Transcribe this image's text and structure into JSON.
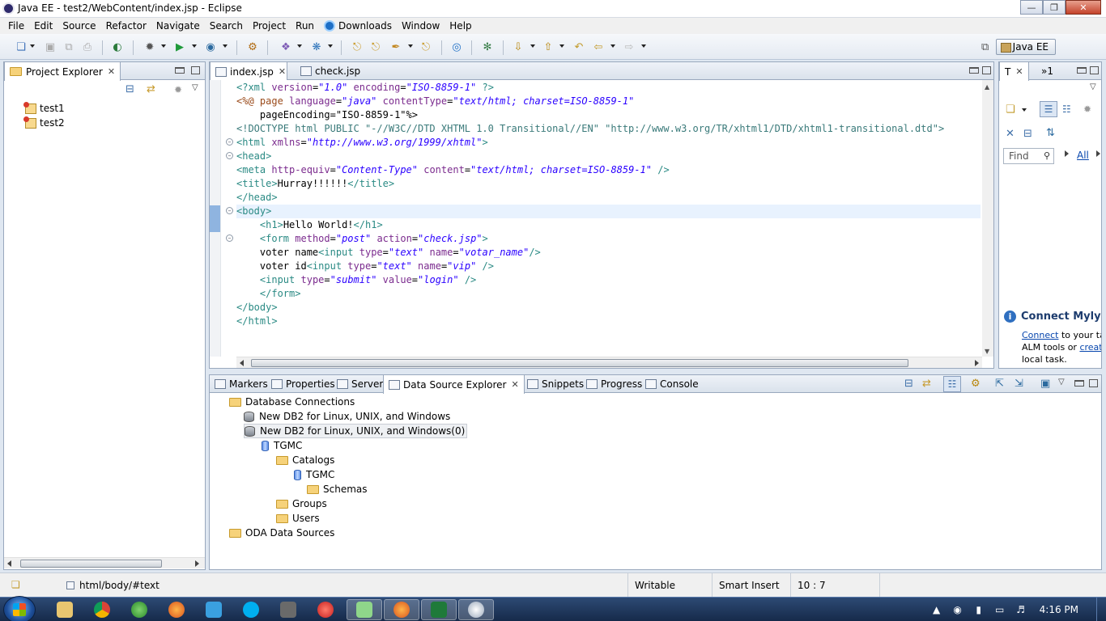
{
  "window": {
    "title": "Java EE - test2/WebContent/index.jsp - Eclipse"
  },
  "menubar": {
    "items": [
      "File",
      "Edit",
      "Source",
      "Refactor",
      "Navigate",
      "Search",
      "Project",
      "Run",
      "Downloads",
      "Window",
      "Help"
    ]
  },
  "perspective": {
    "label": "Java EE"
  },
  "project_explorer": {
    "title": "Project Explorer",
    "projects": [
      "test1",
      "test2"
    ]
  },
  "editor": {
    "tabs": [
      "index.jsp",
      "check.jsp"
    ],
    "lines": [
      "<?xml version=\"1.0\" encoding=\"ISO-8859-1\" ?>",
      "<%@ page language=\"java\" contentType=\"text/html; charset=ISO-8859-1\"",
      "    pageEncoding=\"ISO-8859-1\"%>",
      "<!DOCTYPE html PUBLIC \"-//W3C//DTD XHTML 1.0 Transitional//EN\" \"http://www.w3.org/TR/xhtml1/DTD/xhtml1-transitional.dtd\">",
      "<html xmlns=\"http://www.w3.org/1999/xhtml\">",
      "<head>",
      "<meta http-equiv=\"Content-Type\" content=\"text/html; charset=ISO-8859-1\" />",
      "<title>Hurray!!!!!!</title>",
      "</head>",
      "<body>",
      "    <h1>Hello World!</h1>",
      "    <form method=\"post\" action=\"check.jsp\">",
      "    voter name<input type=\"text\" name=\"votar_name\"/>",
      "    voter id<input type=\"text\" name=\"vip\" />",
      "    <input type=\"submit\" value=\"login\" />",
      "    </form>",
      "</body>",
      "</html>"
    ]
  },
  "task_list": {
    "tab_label": "T",
    "overflow_label": "»1",
    "find_placeholder": "Find",
    "all_label": "All"
  },
  "mylyn": {
    "title": "Connect Mylyn",
    "connect_link": "Connect",
    "line1_rest": " to your ta",
    "line2_prefix": "ALM tools or ",
    "create_link": "creat",
    "line3": "local task."
  },
  "bottom_panel": {
    "tabs": [
      "Markers",
      "Properties",
      "Servers",
      "Data Source Explorer",
      "Snippets",
      "Progress",
      "Console"
    ],
    "tree": {
      "database_connections": "Database Connections",
      "db2_1": "New DB2 for Linux, UNIX, and Windows",
      "db2_2": "New DB2 for Linux, UNIX, and Windows(0)",
      "tgmc": "TGMC",
      "catalogs": "Catalogs",
      "tgmc_catalog": "TGMC",
      "schemas": "Schemas",
      "groups": "Groups",
      "users": "Users",
      "oda": "ODA Data Sources"
    }
  },
  "statusbar": {
    "path": "html/body/#text",
    "mode": "Writable",
    "insert": "Smart Insert",
    "position": "10 : 7"
  },
  "taskbar": {
    "clock": "4:16 PM"
  }
}
